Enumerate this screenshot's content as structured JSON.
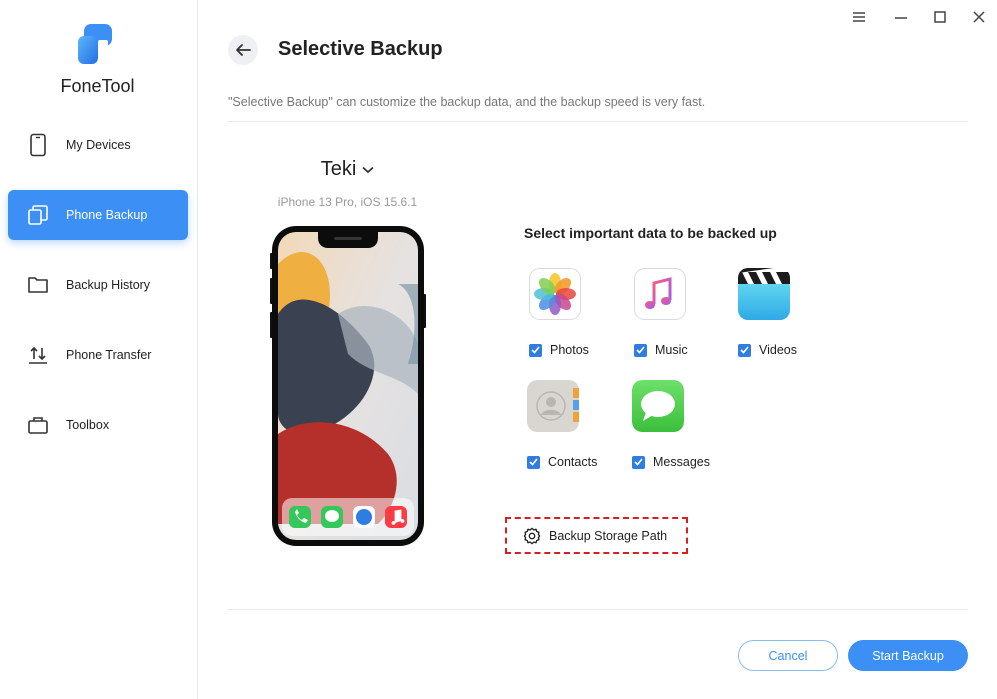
{
  "app": {
    "brand": "FoneTool",
    "accent": "#3b8ff5"
  },
  "sidebar": {
    "items": [
      {
        "label": "My Devices",
        "icon": "phone-icon",
        "active": false
      },
      {
        "label": "Phone Backup",
        "icon": "backup-icon",
        "active": true
      },
      {
        "label": "Backup History",
        "icon": "folder-icon",
        "active": false
      },
      {
        "label": "Phone Transfer",
        "icon": "transfer-icon",
        "active": false
      },
      {
        "label": "Toolbox",
        "icon": "toolbox-icon",
        "active": false
      }
    ]
  },
  "window_controls": [
    "menu-icon",
    "minimize-icon",
    "maximize-icon",
    "close-icon"
  ],
  "header": {
    "title": "Selective Backup",
    "subtitle": "\"Selective Backup\" can customize the backup data, and the backup speed is very fast."
  },
  "device": {
    "name": "Teki",
    "model": "iPhone 13 Pro, iOS 15.6.1"
  },
  "selection": {
    "title": "Select important data to be backed up",
    "items": [
      {
        "label": "Photos",
        "icon": "photos-icon",
        "checked": true
      },
      {
        "label": "Music",
        "icon": "music-icon",
        "checked": true
      },
      {
        "label": "Videos",
        "icon": "videos-icon",
        "checked": true
      },
      {
        "label": "Contacts",
        "icon": "contacts-icon",
        "checked": true
      },
      {
        "label": "Messages",
        "icon": "messages-icon",
        "checked": true
      }
    ]
  },
  "storage": {
    "label": "Backup Storage Path",
    "icon": "gear-icon"
  },
  "buttons": {
    "cancel": "Cancel",
    "start": "Start Backup"
  }
}
